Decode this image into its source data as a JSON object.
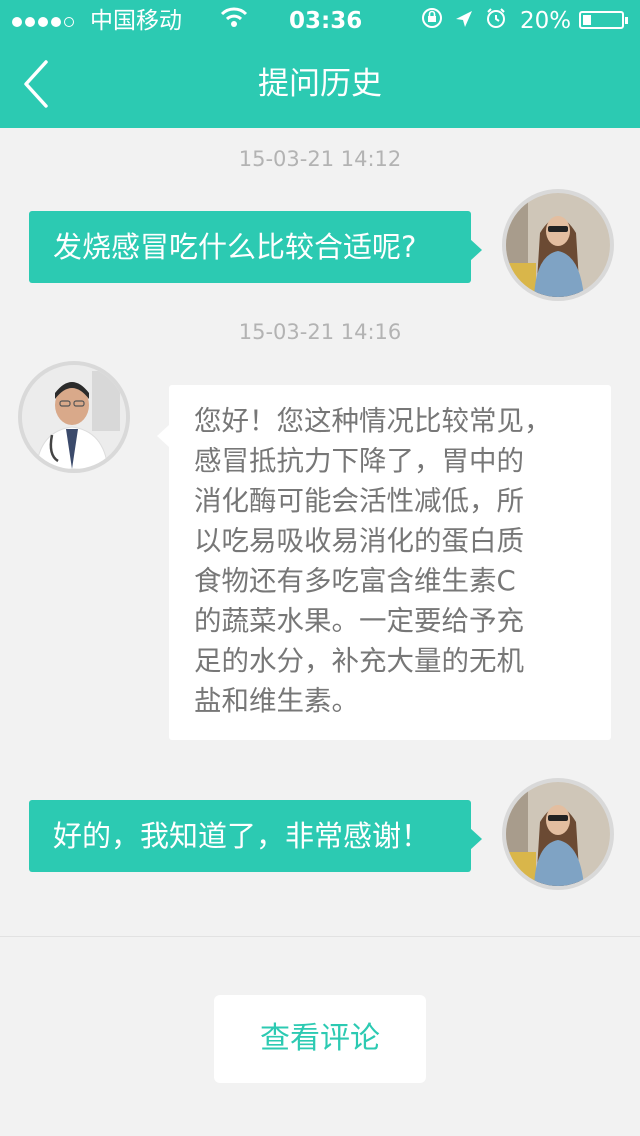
{
  "status_bar": {
    "carrier": "中国移动",
    "time": "03:36",
    "battery": "20%",
    "battery_level": 0.2,
    "signal_dots_filled": 4,
    "signal_dots_total": 5
  },
  "nav": {
    "title": "提问历史",
    "back_icon": "chevron-left-icon"
  },
  "messages": [
    {
      "time": "15-03-21 14:12",
      "sender": "user",
      "text": "发烧感冒吃什么比较合适呢?"
    },
    {
      "time": "15-03-21 14:16",
      "sender": "doctor",
      "lines": [
        "您好！您这种情况比较常见，",
        "感冒抵抗力下降了，胃中的",
        "消化酶可能会活性减低，所",
        "以吃易吸收易消化的蛋白质",
        "食物还有多吃富含维生素C",
        "的蔬菜水果。一定要给予充",
        "足的水分，补充大量的无机",
        "盐和维生素。"
      ]
    },
    {
      "sender": "user",
      "text": "好的，我知道了，非常感谢！"
    }
  ],
  "footer": {
    "review_button": "查看评论"
  },
  "colors": {
    "accent": "#2ccab2",
    "background": "#f2f2f2",
    "timestamp": "#b3b3b3",
    "doctor_text": "#777777"
  }
}
